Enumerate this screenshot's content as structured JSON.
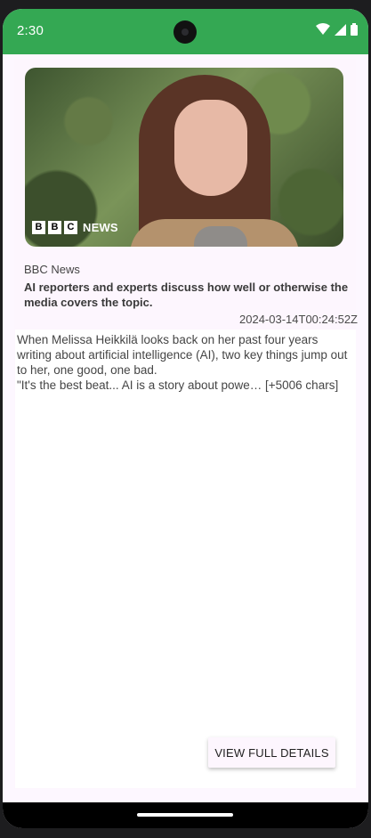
{
  "status_bar": {
    "time": "2:30",
    "color": "#34a853"
  },
  "article": {
    "source": "BBC News",
    "title": "AI reporters and experts discuss how well or otherwise the media covers the topic.",
    "published_at": "2024-03-14T00:24:52Z",
    "description": "When Melissa Heikkilä looks back on her past four years writing about artificial intelligence (AI), two key things jump out to her, one good, one bad.\n\"It's the best beat... AI is a story about powe… [+5006 chars]",
    "image_logo": {
      "boxes": [
        "B",
        "B",
        "C"
      ],
      "word": "NEWS"
    }
  },
  "actions": {
    "view_full_details": "VIEW FULL DETAILS"
  }
}
